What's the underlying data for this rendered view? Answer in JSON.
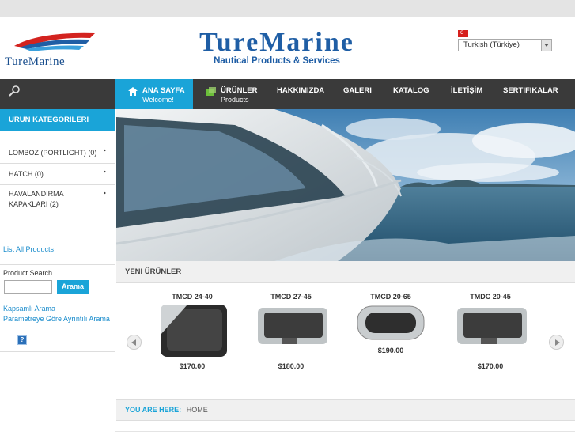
{
  "header": {
    "logo_text": "TureMarine",
    "brand_title": "TureMarine",
    "brand_tagline": "Nautical Products & Services",
    "language_selected": "Turkish (Türkiye)",
    "flag_text": "C"
  },
  "nav": {
    "items": [
      {
        "label": "ANA SAYFA",
        "sub": "Welcome!"
      },
      {
        "label": "ÜRÜNLER",
        "sub": "Products"
      },
      {
        "label": "HAKKIMIZDA",
        "sub": ""
      },
      {
        "label": "GALERI",
        "sub": ""
      },
      {
        "label": "KATALOG",
        "sub": ""
      },
      {
        "label": "İLETİŞİM",
        "sub": ""
      },
      {
        "label": "SERTIFIKALAR",
        "sub": ""
      }
    ]
  },
  "sidebar": {
    "heading": "ÜRÜN KATEGORİLERİ",
    "categories": [
      {
        "label": "LOMBOZ (PORTLIGHT) (0)"
      },
      {
        "label": "HATCH (0)"
      },
      {
        "label": "HAVALANDIRMA KAPAKLARI (2)"
      }
    ],
    "list_all": "List All Products",
    "product_search_label": "Product Search",
    "search_button": "Arama",
    "advanced_search": "Kapsamlı Arama",
    "parametric_search": "Parametreye Göre Ayrıntılı Arama",
    "help_icon_text": "?"
  },
  "new_products": {
    "heading": "YENI ÜRÜNLER",
    "items": [
      {
        "name": "TMCD 24-40",
        "price": "$170.00"
      },
      {
        "name": "TMCD 27-45",
        "price": "$180.00"
      },
      {
        "name": "TMCD 20-65",
        "price": "$190.00"
      },
      {
        "name": "TMDC 20-45",
        "price": "$170.00"
      }
    ]
  },
  "breadcrumb": {
    "label": "YOU ARE HERE:",
    "current": "HOME"
  },
  "colors": {
    "accent": "#1aa4d8",
    "nav_bg": "#3a3a3a",
    "brand": "#1f5ea5"
  }
}
